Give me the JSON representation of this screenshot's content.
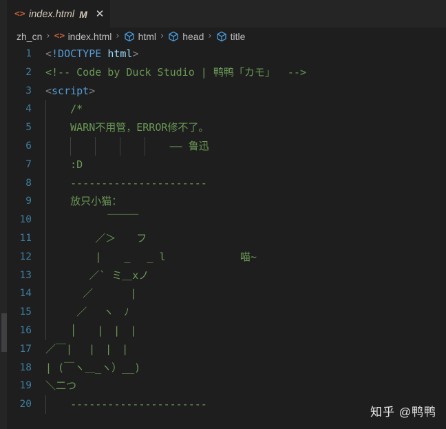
{
  "window": {
    "background": "#1e1e1e",
    "chrome_background": "#252526"
  },
  "tab": {
    "icon": "html-code-icon",
    "label": "index.html",
    "dirty_badge": "M",
    "close_label": "✕"
  },
  "breadcrumbs": {
    "separator": "›",
    "items": [
      {
        "icon": "folder-crumb",
        "label": "zh_cn"
      },
      {
        "icon": "html-code-icon",
        "label": "index.html"
      },
      {
        "icon": "symbol-field-icon",
        "label": "html"
      },
      {
        "icon": "symbol-field-icon",
        "label": "head"
      },
      {
        "icon": "symbol-field-icon",
        "label": "title"
      }
    ]
  },
  "editor": {
    "language": "html",
    "first_line": 1,
    "lines": [
      {
        "number": "1",
        "guides": 0,
        "spans": [
          {
            "text": "<",
            "cls": "tok-punct"
          },
          {
            "text": "!DOCTYPE ",
            "cls": "tok-tag"
          },
          {
            "text": "html",
            "cls": "tok-attr"
          },
          {
            "text": ">",
            "cls": "tok-punct"
          }
        ]
      },
      {
        "number": "2",
        "guides": 0,
        "spans": [
          {
            "text": "<!-- Code by Duck Studio | 鸭鸭「カモ」  -->",
            "cls": "tok-comment"
          }
        ]
      },
      {
        "number": "3",
        "guides": 0,
        "spans": [
          {
            "text": "<",
            "cls": "tok-punct"
          },
          {
            "text": "script",
            "cls": "tok-tag"
          },
          {
            "text": ">",
            "cls": "tok-punct"
          }
        ]
      },
      {
        "number": "4",
        "guides": 1,
        "spans": [
          {
            "text": "    /*",
            "cls": "tok-comment"
          }
        ]
      },
      {
        "number": "5",
        "guides": 1,
        "spans": [
          {
            "text": "    WARN不用管，ERROR修不了。",
            "cls": "tok-comment"
          }
        ]
      },
      {
        "number": "6",
        "guides": 5,
        "spans": [
          {
            "text": "                    —— 鲁迅",
            "cls": "tok-comment"
          }
        ]
      },
      {
        "number": "7",
        "guides": 1,
        "spans": [
          {
            "text": "    :D",
            "cls": "tok-comment"
          }
        ]
      },
      {
        "number": "8",
        "guides": 1,
        "spans": [
          {
            "text": "    ----------------------",
            "cls": "tok-comment"
          }
        ]
      },
      {
        "number": "9",
        "guides": 1,
        "spans": [
          {
            "text": "    放只小猫：",
            "cls": "tok-comment"
          }
        ]
      },
      {
        "number": "10",
        "guides": 1,
        "spans": [
          {
            "text": "          ￣￣￣",
            "cls": "tok-cat"
          }
        ]
      },
      {
        "number": "11",
        "guides": 1,
        "spans": [
          {
            "text": "        ／＞　　フ",
            "cls": "tok-cat"
          }
        ]
      },
      {
        "number": "12",
        "guides": 1,
        "spans": [
          {
            "text": "        |  　_　 _ l            喵~",
            "cls": "tok-cat"
          }
        ]
      },
      {
        "number": "13",
        "guides": 1,
        "spans": [
          {
            "text": "       ／` ミ＿xノ",
            "cls": "tok-cat"
          }
        ]
      },
      {
        "number": "14",
        "guides": 1,
        "spans": [
          {
            "text": "      ／　　　 |",
            "cls": "tok-cat"
          }
        ]
      },
      {
        "number": "15",
        "guides": 1,
        "spans": [
          {
            "text": "     ／　 ヽ　ﾉ",
            "cls": "tok-cat"
          }
        ]
      },
      {
        "number": "16",
        "guides": 1,
        "spans": [
          {
            "text": "    │　　|　|　|",
            "cls": "tok-cat"
          }
        ]
      },
      {
        "number": "17",
        "guides": 0,
        "spans": [
          {
            "text": "／￣|　 |　|　|",
            "cls": "tok-cat"
          }
        ]
      },
      {
        "number": "18",
        "guides": 0,
        "spans": [
          {
            "text": "| (￣ヽ＿_ヽ）__)",
            "cls": "tok-cat"
          }
        ]
      },
      {
        "number": "19",
        "guides": 0,
        "spans": [
          {
            "text": "＼二つ",
            "cls": "tok-cat"
          }
        ]
      },
      {
        "number": "20",
        "guides": 1,
        "spans": [
          {
            "text": "    ----------------------",
            "cls": "tok-comment"
          }
        ]
      }
    ]
  },
  "watermark": {
    "text": "知乎 @鸭鸭"
  }
}
